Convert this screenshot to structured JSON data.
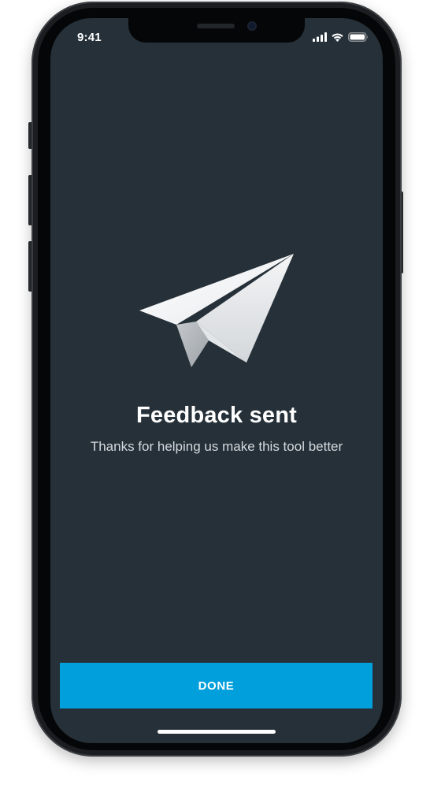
{
  "status_bar": {
    "time": "9:41",
    "icons": [
      "cellular-signal-icon",
      "wifi-icon",
      "battery-icon"
    ]
  },
  "confirmation": {
    "illustration": "paper-plane-icon",
    "title": "Feedback sent",
    "message": "Thanks for helping us make this tool better"
  },
  "actions": {
    "done_label": "DONE"
  },
  "colors": {
    "screen_background": "#263038",
    "primary_button": "#019fdc",
    "title_text": "#ffffff",
    "message_text": "#d5dbe0"
  }
}
